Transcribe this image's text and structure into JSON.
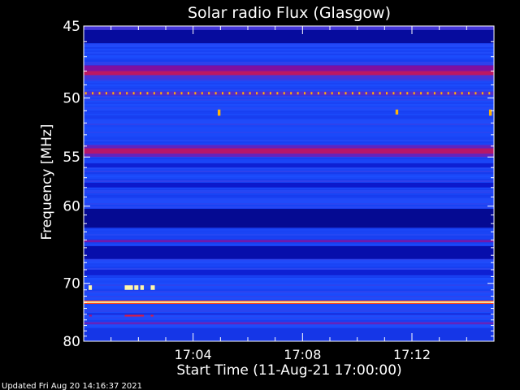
{
  "chart_data": {
    "type": "heatmap",
    "title": "Solar radio Flux (Glasgow)",
    "xlabel": "Start Time (11-Aug-21 17:00:00)",
    "ylabel": "Frequency [MHz]",
    "x_unit": "minutes after 17:00",
    "xlim": [
      0,
      15
    ],
    "ylim": [
      45,
      80
    ],
    "y_scale": "reciprocal",
    "x_ticks": [
      {
        "value": 4,
        "label": "17:04"
      },
      {
        "value": 8,
        "label": "17:08"
      },
      {
        "value": 12,
        "label": "17:12"
      }
    ],
    "y_ticks": [
      {
        "value": 45,
        "label": "45"
      },
      {
        "value": 50,
        "label": "50"
      },
      {
        "value": 55,
        "label": "55"
      },
      {
        "value": 60,
        "label": "60"
      },
      {
        "value": 70,
        "label": "70"
      },
      {
        "value": 80,
        "label": "80"
      }
    ],
    "colormap": [
      "#000060",
      "#0a14c8",
      "#1e50ff",
      "#8010a0",
      "#ff2020",
      "#ffd800",
      "#ffffe0"
    ],
    "background_level": 0.32,
    "bands": [
      {
        "f0": 45.0,
        "f1": 45.25,
        "level": 0.4
      },
      {
        "f0": 45.25,
        "f1": 46.1,
        "level": 0.1
      },
      {
        "f0": 47.6,
        "f1": 48.0,
        "level": 0.5
      },
      {
        "f0": 48.0,
        "f1": 48.3,
        "level": 0.58
      },
      {
        "f0": 48.3,
        "f1": 48.6,
        "level": 0.4
      },
      {
        "f0": 49.5,
        "f1": 49.8,
        "level": 0.42
      },
      {
        "f0": 53.9,
        "f1": 54.2,
        "level": 0.45
      },
      {
        "f0": 54.2,
        "f1": 54.7,
        "level": 0.57
      },
      {
        "f0": 54.7,
        "f1": 55.0,
        "level": 0.45
      },
      {
        "f0": 55.6,
        "f1": 56.0,
        "level": 0.2
      },
      {
        "f0": 57.5,
        "f1": 58.0,
        "level": 0.18
      },
      {
        "f0": 60.3,
        "f1": 62.5,
        "level": 0.08
      },
      {
        "f0": 64.0,
        "f1": 64.3,
        "level": 0.48
      },
      {
        "f0": 64.8,
        "f1": 66.5,
        "level": 0.12
      },
      {
        "f0": 68.0,
        "f1": 68.8,
        "level": 0.2
      },
      {
        "f0": 72.7,
        "f1": 72.85,
        "level": 0.7
      },
      {
        "f0": 72.85,
        "f1": 73.1,
        "level": 0.95
      },
      {
        "f0": 73.1,
        "f1": 73.25,
        "level": 0.7
      },
      {
        "f0": 74.8,
        "f1": 75.1,
        "level": 0.24
      },
      {
        "f0": 76.4,
        "f1": 76.8,
        "level": 0.45
      },
      {
        "f0": 77.5,
        "f1": 80.0,
        "level": 0.26
      }
    ],
    "events": [
      {
        "t0": 0.18,
        "t1": 0.3,
        "f0": 70.3,
        "f1": 71.0,
        "level": 0.96
      },
      {
        "t0": 1.5,
        "t1": 1.8,
        "f0": 70.3,
        "f1": 71.0,
        "level": 0.96
      },
      {
        "t0": 1.85,
        "t1": 2.0,
        "f0": 70.3,
        "f1": 71.0,
        "level": 0.96
      },
      {
        "t0": 2.07,
        "t1": 2.2,
        "f0": 70.3,
        "f1": 71.0,
        "level": 0.96
      },
      {
        "t0": 2.45,
        "t1": 2.6,
        "f0": 70.3,
        "f1": 71.0,
        "level": 0.96
      },
      {
        "t0": 4.9,
        "t1": 5.0,
        "f0": 50.9,
        "f1": 51.4,
        "level": 0.8
      },
      {
        "t0": 11.4,
        "t1": 11.5,
        "f0": 50.9,
        "f1": 51.3,
        "level": 0.8
      },
      {
        "t0": 14.82,
        "t1": 14.92,
        "f0": 50.9,
        "f1": 51.4,
        "level": 0.8
      },
      {
        "t0": 1.5,
        "t1": 2.2,
        "f0": 75.1,
        "f1": 75.4,
        "level": 0.62
      },
      {
        "t0": 2.45,
        "t1": 2.55,
        "f0": 75.1,
        "f1": 75.4,
        "level": 0.62
      },
      {
        "t0": 0.2,
        "t1": 0.3,
        "f0": 75.1,
        "f1": 75.4,
        "level": 0.55
      }
    ],
    "dotted_line": {
      "f": 49.6,
      "level": 0.8,
      "spacing_min": 0.25
    },
    "grid": false,
    "legend": "none"
  },
  "footer": {
    "updated": "Updated Fri Aug 20 14:16:37 2021"
  }
}
